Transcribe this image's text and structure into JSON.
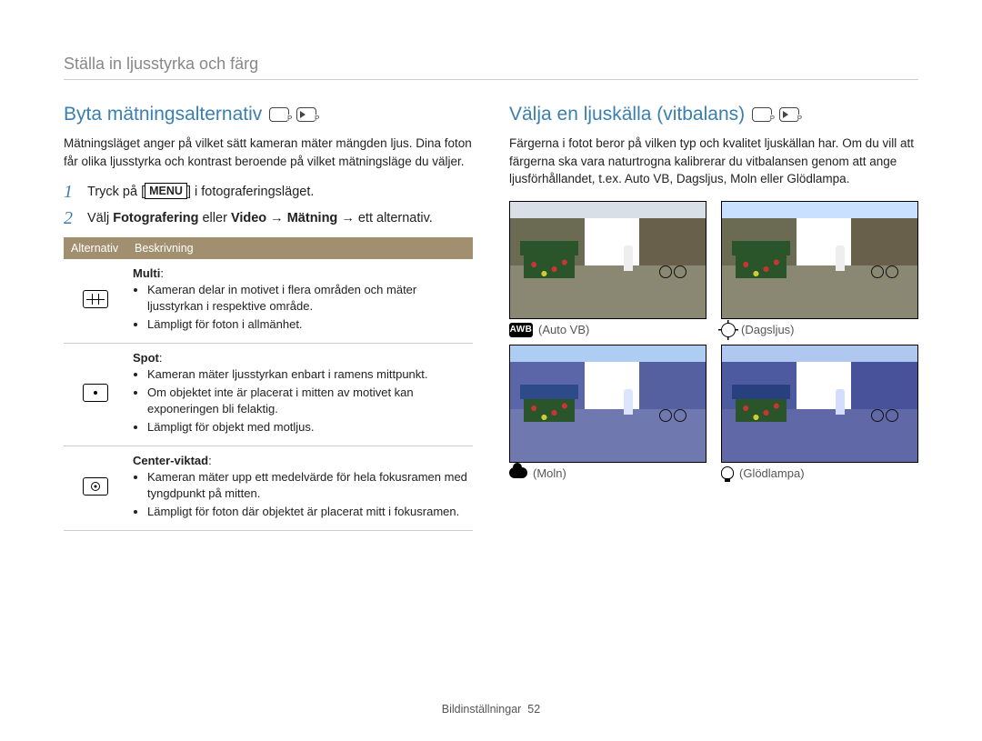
{
  "page_header": "Ställa in ljusstyrka och färg",
  "left": {
    "title": "Byta mätningsalternativ",
    "intro": "Mätningsläget anger på vilket sätt kameran mäter mängden ljus. Dina foton får olika ljusstyrka och kontrast beroende på vilket mätningsläge du väljer.",
    "step1_pre": "Tryck på [",
    "step1_menu": "MENU",
    "step1_post": "] i fotograferingsläget.",
    "step2_a": "Välj ",
    "step2_b": "Fotografering",
    "step2_c": " eller ",
    "step2_d": "Video",
    "step2_e": " → ",
    "step2_f": "Mätning",
    "step2_g": " → ett alternativ.",
    "table_head_1": "Alternativ",
    "table_head_2": "Beskrivning",
    "rows": [
      {
        "name": "Multi",
        "b1": "Kameran delar in motivet i flera områden och mäter ljusstyrkan i respektive område.",
        "b2": "Lämpligt för foton i allmänhet."
      },
      {
        "name": "Spot",
        "b1": "Kameran mäter ljusstyrkan enbart i ramens mittpunkt.",
        "b2": "Om objektet inte är placerat i mitten av motivet kan exponeringen bli felaktig.",
        "b3": "Lämpligt för objekt med motljus."
      },
      {
        "name": "Center-viktad",
        "b1": "Kameran mäter upp ett medelvärde för hela fokusramen med tyngdpunkt på mitten.",
        "b2": "Lämpligt för foton där objektet är placerat mitt i fokusramen."
      }
    ]
  },
  "right": {
    "title": "Välja en ljuskälla (vitbalans)",
    "intro": "Färgerna i fotot beror på vilken typ och kvalitet ljuskällan har. Om du vill att färgerna ska vara naturtrogna kalibrerar du vitbalansen genom att ange ljusförhållandet, t.ex. Auto VB, Dagsljus, Moln eller Glödlampa.",
    "awb_badge": "AWB",
    "labels": {
      "auto": "(Auto VB)",
      "day": "(Dagsljus)",
      "cloud": "(Moln)",
      "tung": "(Glödlampa)"
    }
  },
  "footer_section": "Bildinställningar",
  "footer_page": "52"
}
